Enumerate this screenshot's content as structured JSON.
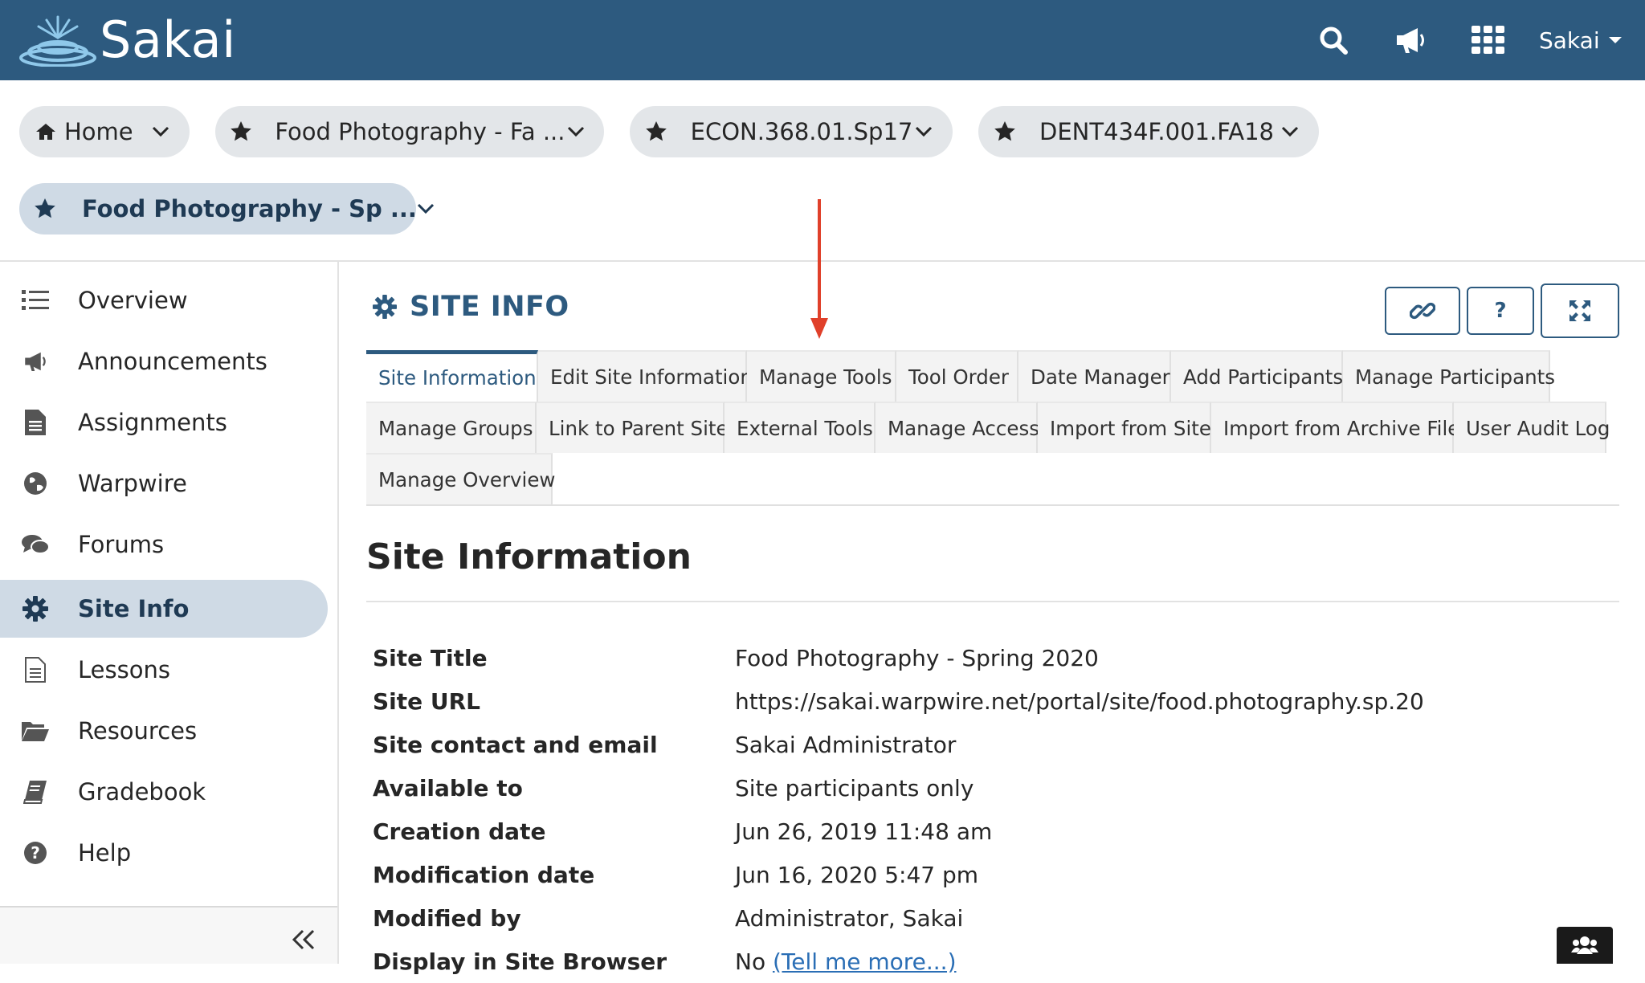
{
  "header": {
    "brand": "Sakai",
    "user_label": "Sakai",
    "icons": [
      "search-icon",
      "megaphone-icon",
      "apps-grid-icon",
      "caret-down-icon"
    ]
  },
  "sites": [
    {
      "label": "Home",
      "icon": "home-icon"
    },
    {
      "label": "Food Photography - Fa ...",
      "icon": "star-icon"
    },
    {
      "label": "ECON.368.01.Sp17",
      "icon": "star-icon"
    },
    {
      "label": "DENT434F.001.FA18",
      "icon": "star-icon"
    },
    {
      "label": "Food Photography - Sp ...",
      "icon": "star-icon",
      "current": true
    }
  ],
  "nav": {
    "items": [
      {
        "label": "Overview",
        "icon": "list-icon"
      },
      {
        "label": "Announcements",
        "icon": "megaphone-icon"
      },
      {
        "label": "Assignments",
        "icon": "document-icon"
      },
      {
        "label": "Warpwire",
        "icon": "globe-icon"
      },
      {
        "label": "Forums",
        "icon": "chat-icon"
      },
      {
        "label": "Site Info",
        "icon": "gear-icon",
        "active": true
      },
      {
        "label": "Lessons",
        "icon": "page-icon"
      },
      {
        "label": "Resources",
        "icon": "folder-icon"
      },
      {
        "label": "Gradebook",
        "icon": "book-icon"
      },
      {
        "label": "Help",
        "icon": "help-icon"
      }
    ]
  },
  "tool": {
    "title": "SITE INFO",
    "help_label": "?",
    "buttons": [
      "link-icon",
      "help-icon",
      "expand-icon"
    ]
  },
  "tabs": [
    [
      "Site Information",
      "Edit Site Information",
      "Manage Tools",
      "Tool Order",
      "Date Manager",
      "Add Participants",
      "Manage Participants"
    ],
    [
      "Manage Groups",
      "Link to Parent Site",
      "External Tools",
      "Manage Access",
      "Import from Site",
      "Import from Archive File",
      "User Audit Log"
    ],
    [
      "Manage Overview"
    ]
  ],
  "active_tab": "Site Information",
  "section": {
    "title": "Site Information",
    "rows": [
      {
        "label": "Site Title",
        "value": "Food Photography - Spring 2020"
      },
      {
        "label": "Site URL",
        "value": "https://sakai.warpwire.net/portal/site/food.photography.sp.20"
      },
      {
        "label": "Site contact and email",
        "value": "Sakai Administrator"
      },
      {
        "label": "Available to",
        "value": "Site participants only"
      },
      {
        "label": "Creation date",
        "value": "Jun 26, 2019 11:48 am"
      },
      {
        "label": "Modification date",
        "value": "Jun 16, 2020 5:47 pm"
      },
      {
        "label": "Modified by",
        "value": "Administrator, Sakai"
      },
      {
        "label": "Display in Site Browser",
        "value": "No",
        "link": "(Tell me more...)"
      }
    ]
  },
  "colors": {
    "header_bg": "#2d5a7f",
    "accent": "#2d5a7f",
    "active_bg": "#cfdae5",
    "annotation_arrow": "#e0402a"
  }
}
